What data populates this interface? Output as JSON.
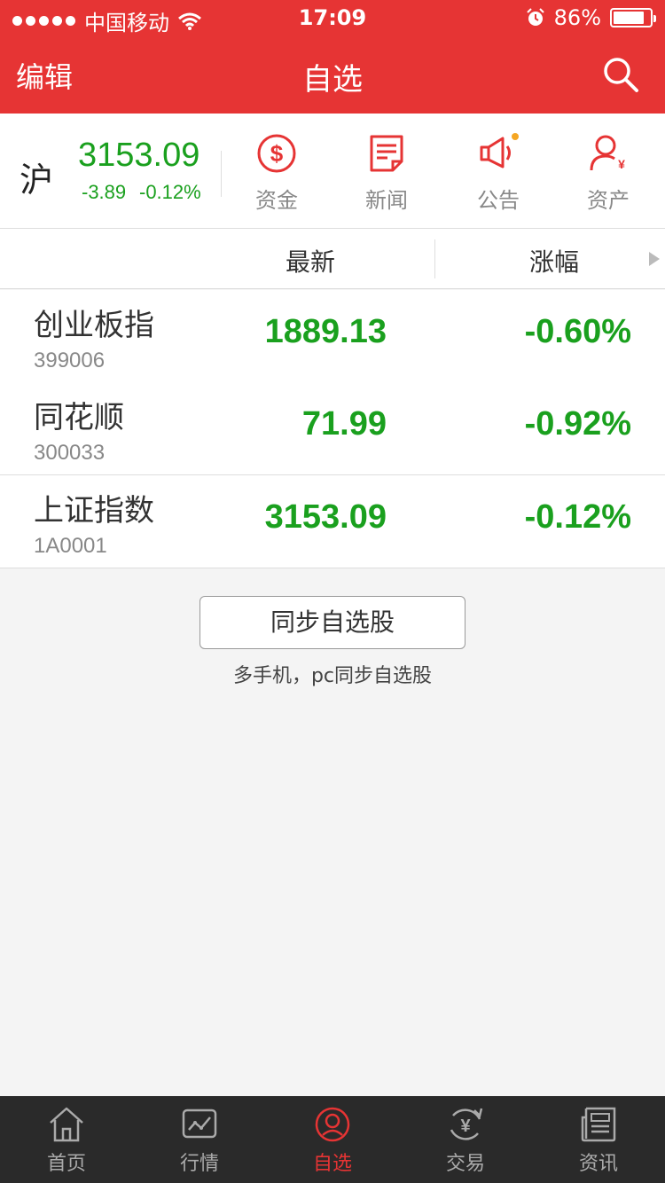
{
  "status_bar": {
    "carrier": "中国移动",
    "time": "17:09",
    "battery": "86%",
    "battery_level": 0.86
  },
  "nav": {
    "edit_label": "编辑",
    "title": "自选",
    "search_icon": "search-icon"
  },
  "index": {
    "name": "沪",
    "price": "3153.09",
    "change": "-3.89",
    "change_pct": "-0.12%"
  },
  "shortcuts": [
    {
      "label": "资金",
      "icon": "dollar-circle-icon"
    },
    {
      "label": "新闻",
      "icon": "news-document-icon"
    },
    {
      "label": "公告",
      "icon": "megaphone-icon",
      "badge": true
    },
    {
      "label": "资产",
      "icon": "user-yuan-icon"
    }
  ],
  "table": {
    "col_latest": "最新",
    "col_change": "涨幅",
    "rows": [
      {
        "name": "创业板指",
        "code": "399006",
        "price": "1889.13",
        "change_pct": "-0.60%"
      },
      {
        "name": "同花顺",
        "code": "300033",
        "price": "71.99",
        "change_pct": "-0.92%"
      },
      {
        "name": "上证指数",
        "code": "1A0001",
        "price": "3153.09",
        "change_pct": "-0.12%"
      }
    ]
  },
  "sync": {
    "button_label": "同步自选股",
    "hint": "多手机，pc同步自选股"
  },
  "tabbar": {
    "tabs": [
      {
        "label": "首页",
        "icon": "home-icon"
      },
      {
        "label": "行情",
        "icon": "chart-icon"
      },
      {
        "label": "自选",
        "icon": "watchlist-icon",
        "active": true
      },
      {
        "label": "交易",
        "icon": "yuan-exchange-icon"
      },
      {
        "label": "资讯",
        "icon": "newspaper-icon"
      }
    ]
  },
  "colors": {
    "brand_red": "#e63434",
    "down_green": "#1aa01e",
    "tabbar_bg": "#2a2a2a"
  }
}
